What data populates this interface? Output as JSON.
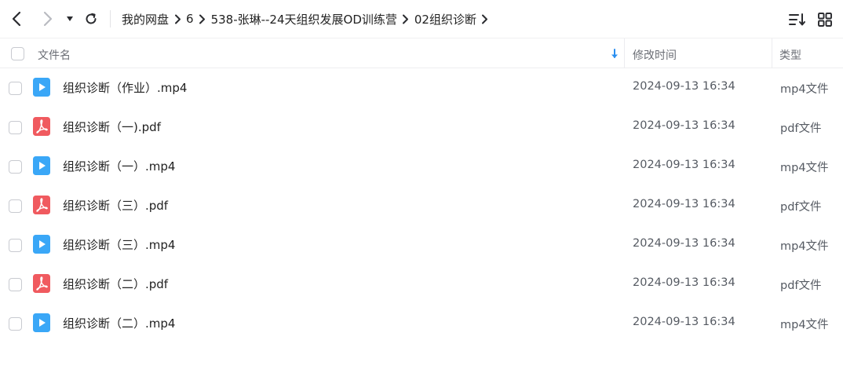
{
  "toolbar": {
    "breadcrumb": [
      "我的网盘",
      "6",
      "538-张琳--24天组织发展OD训练营",
      "02组织诊断"
    ]
  },
  "columns": {
    "name": "文件名",
    "modified": "修改时间",
    "type": "类型"
  },
  "colors": {
    "video_icon": "#3aa7f7",
    "pdf_icon": "#f05a5f",
    "sort_arrow": "#2b8ff0"
  },
  "files": [
    {
      "name": "组织诊断（作业）.mp4",
      "modified": "2024-09-13 16:34",
      "type": "mp4文件",
      "icon": "video-icon"
    },
    {
      "name": "组织诊断（一).pdf",
      "modified": "2024-09-13 16:34",
      "type": "pdf文件",
      "icon": "pdf-icon"
    },
    {
      "name": "组织诊断（一）.mp4",
      "modified": "2024-09-13 16:34",
      "type": "mp4文件",
      "icon": "video-icon"
    },
    {
      "name": "组织诊断（三）.pdf",
      "modified": "2024-09-13 16:34",
      "type": "pdf文件",
      "icon": "pdf-icon"
    },
    {
      "name": "组织诊断（三）.mp4",
      "modified": "2024-09-13 16:34",
      "type": "mp4文件",
      "icon": "video-icon"
    },
    {
      "name": "组织诊断（二）.pdf",
      "modified": "2024-09-13 16:34",
      "type": "pdf文件",
      "icon": "pdf-icon"
    },
    {
      "name": "组织诊断（二）.mp4",
      "modified": "2024-09-13 16:34",
      "type": "mp4文件",
      "icon": "video-icon"
    }
  ]
}
